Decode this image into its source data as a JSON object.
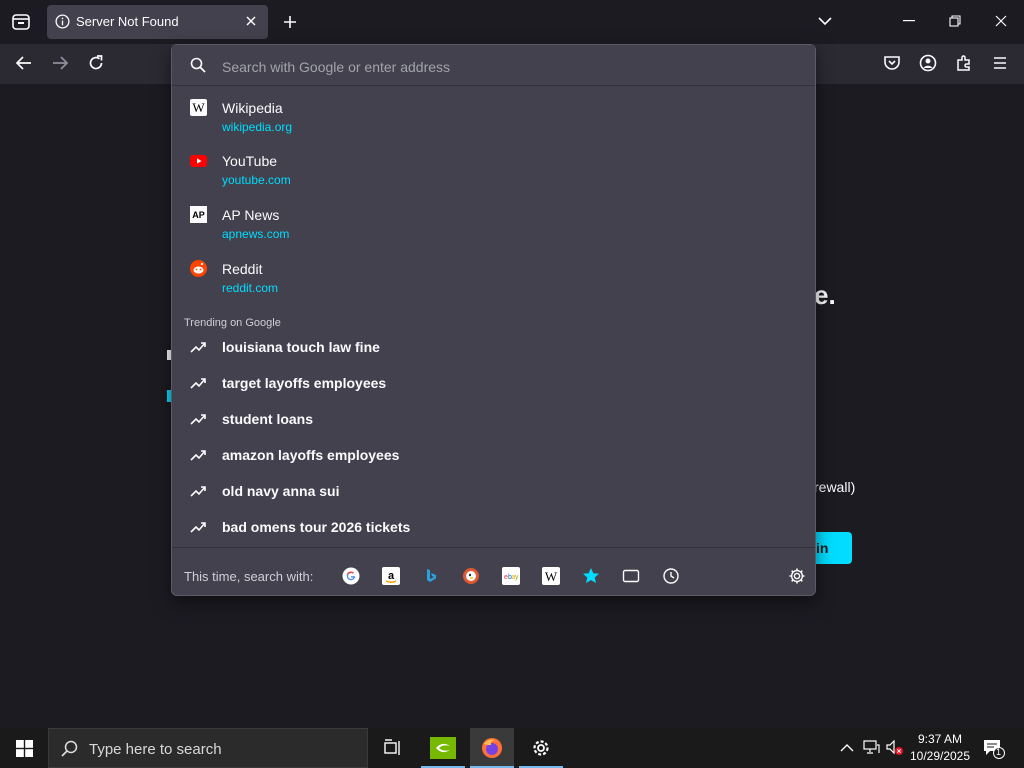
{
  "tab": {
    "title": "Server Not Found"
  },
  "urlbar": {
    "placeholder": "Search with Google or enter address"
  },
  "results": [
    {
      "title": "Wikipedia",
      "url": "wikipedia.org"
    },
    {
      "title": "YouTube",
      "url": "youtube.com"
    },
    {
      "title": "AP News",
      "url": "apnews.com"
    },
    {
      "title": "Reddit",
      "url": "reddit.com"
    }
  ],
  "trending": {
    "label": "Trending on Google",
    "items": [
      "louisiana touch law fine",
      "target layoffs employees",
      "student loans",
      "amazon layoffs employees",
      "old navy anna sui",
      "bad omens tour 2026 tickets"
    ]
  },
  "footer": {
    "label": "This time, search with:"
  },
  "page": {
    "fragment_1": "e.",
    "fragment_2": "rewall)",
    "button_fragment": "in"
  },
  "taskbar": {
    "search_placeholder": "Type here to search",
    "time": "9:37 AM",
    "date": "10/29/2025",
    "notification_count": "1"
  },
  "colors": {
    "accent": "#00ddff",
    "popup_bg": "#42414d",
    "toolbar_bg": "#2b2a33"
  }
}
